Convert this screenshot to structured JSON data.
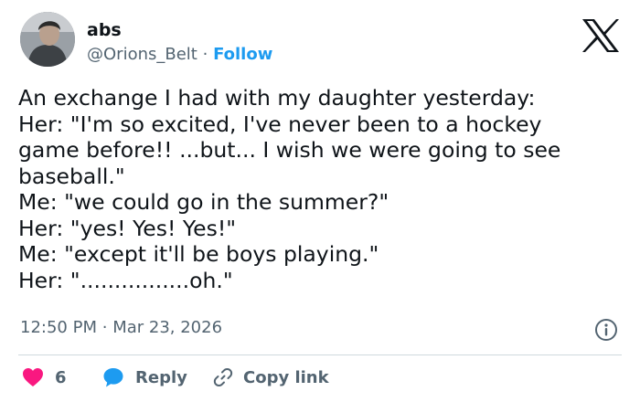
{
  "author": {
    "name": "abs",
    "handle": "@Orions_Belt",
    "separator": "·",
    "follow_label": "Follow"
  },
  "tweet": {
    "lines": [
      "An exchange I had with my daughter yesterday:",
      "Her: \"I'm so excited, I've never been to a hockey",
      "game before!! ...but... I wish we were going to see",
      "baseball.\"",
      "Me: \"we could go in the summer?\"",
      "Her: \"yes! Yes! Yes!\"",
      "Me: \"except it'll be boys playing.\"",
      "Her: \"................oh.\""
    ],
    "time": "12:50 PM",
    "separator": "·",
    "date": "Mar 23, 2026"
  },
  "actions": {
    "like_count": "6",
    "reply_label": "Reply",
    "copy_link_label": "Copy link"
  },
  "icons": {
    "logo": "x-logo-icon",
    "info": "info-icon",
    "like": "heart-icon",
    "reply": "speech-bubble-icon",
    "copy": "link-icon"
  },
  "colors": {
    "text": "#0f1419",
    "secondary": "#536471",
    "accent": "#1d9bf0",
    "like": "#f91880",
    "divider": "#cfd9de"
  }
}
